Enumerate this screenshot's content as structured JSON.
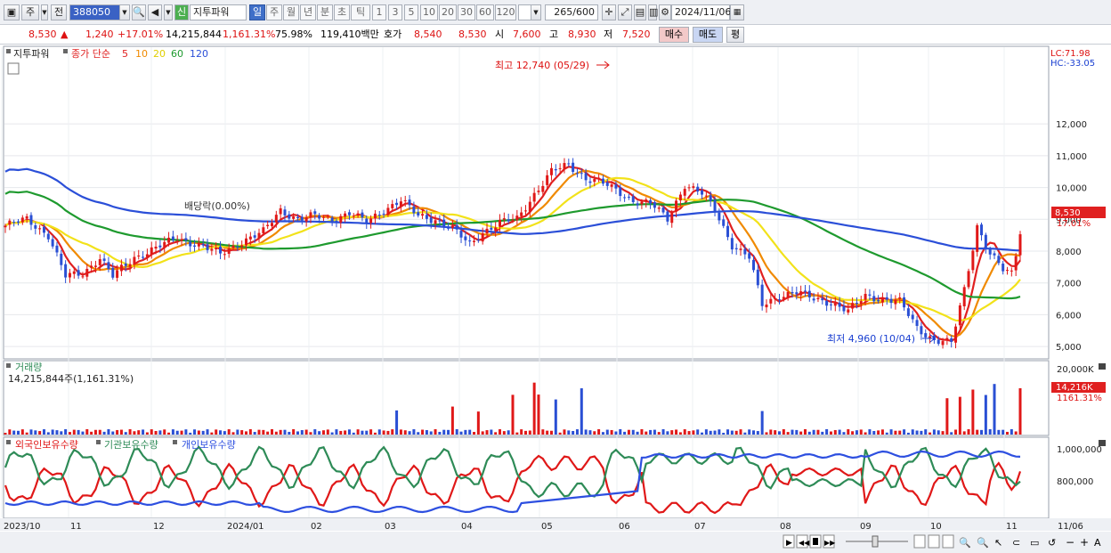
{
  "toolbar": {
    "market_label": "주",
    "prev_label": "전",
    "code": "388050",
    "stock_name": "지투파워",
    "new_badge": "신",
    "periods": [
      "일",
      "주",
      "월",
      "년",
      "분",
      "초",
      "틱"
    ],
    "active_period": "일",
    "intervals": [
      "1",
      "3",
      "5",
      "10",
      "20",
      "30",
      "60",
      "120"
    ],
    "count": "265",
    "count_total": "/600",
    "date": "2024/11/06"
  },
  "quote": {
    "price": "8,530",
    "change": "1,240",
    "change_pct": "+17.01%",
    "volume": "14,215,844",
    "volume_pct": "1,161.31%",
    "rate": "75.98%",
    "amount": "119,410백만",
    "hoga_label": "호가",
    "ask": "8,540",
    "bid": "8,530",
    "open_label": "시",
    "open": "7,600",
    "high_label": "고",
    "high": "8,930",
    "low_label": "저",
    "low": "7,520",
    "buy_label": "매수",
    "sell_label": "매도",
    "avg_label": "평"
  },
  "price_panel": {
    "title": "지투파워",
    "ma_label": "종가 단순",
    "ma_periods": [
      "5",
      "10",
      "20",
      "60",
      "120"
    ],
    "ma_colors": [
      "#e02020",
      "#f08a00",
      "#f2e21a",
      "#1e9a2e",
      "#2b4fd8"
    ],
    "lc": "LC:71.98",
    "hc": "HC:-33.05",
    "price_badge": "8,530",
    "pct_badge": "17.01%",
    "high_annot": "최고 12,740 (05/29)",
    "low_annot": "최저 4,960 (10/04)",
    "dividend": "배당락(0.00%)"
  },
  "volume_panel": {
    "title": "거래량",
    "value": "14,215,844주(1,161.31%)",
    "badge": "14,216K",
    "badge_pct": "1161.31%"
  },
  "holdings_panel": {
    "series_labels": [
      "외국인보유수량",
      "기관보유수량",
      "개인보유수량"
    ],
    "series_colors": [
      "#e01818",
      "#2e8b57",
      "#2d4fe0"
    ]
  },
  "x_labels": [
    "2023/10",
    "11",
    "12",
    "2024/01",
    "02",
    "03",
    "04",
    "05",
    "06",
    "07",
    "08",
    "09",
    "10",
    "11",
    "11/06"
  ],
  "chart_data": {
    "type": "candlestick",
    "ylim": [
      4500,
      12900
    ],
    "y_ticks": [
      "12,000",
      "11,000",
      "10,000",
      "9,000",
      "8,000",
      "7,000",
      "6,000",
      "5,000"
    ],
    "volume_ticks": [
      "20,000K"
    ],
    "holdings_ticks": [
      "1,000,000",
      "800,000"
    ],
    "close_anchors": [
      [
        0,
        8800
      ],
      [
        5,
        9000
      ],
      [
        10,
        8500
      ],
      [
        14,
        7200
      ],
      [
        18,
        7300
      ],
      [
        22,
        7800
      ],
      [
        25,
        7200
      ],
      [
        30,
        7800
      ],
      [
        35,
        8100
      ],
      [
        40,
        8400
      ],
      [
        45,
        8200
      ],
      [
        50,
        7900
      ],
      [
        55,
        8300
      ],
      [
        60,
        8600
      ],
      [
        64,
        9300
      ],
      [
        68,
        9000
      ],
      [
        72,
        9100
      ],
      [
        76,
        9000
      ],
      [
        80,
        9200
      ],
      [
        84,
        8900
      ],
      [
        88,
        9300
      ],
      [
        92,
        9600
      ],
      [
        96,
        9100
      ],
      [
        100,
        9000
      ],
      [
        104,
        8700
      ],
      [
        108,
        8200
      ],
      [
        111,
        8600
      ],
      [
        115,
        8900
      ],
      [
        119,
        9000
      ],
      [
        123,
        9800
      ],
      [
        127,
        10500
      ],
      [
        131,
        10700
      ],
      [
        135,
        10300
      ],
      [
        138,
        10200
      ],
      [
        142,
        9900
      ],
      [
        146,
        9600
      ],
      [
        150,
        9500
      ],
      [
        154,
        9000
      ],
      [
        158,
        10100
      ],
      [
        162,
        9800
      ],
      [
        165,
        9300
      ],
      [
        169,
        8200
      ],
      [
        173,
        7800
      ],
      [
        176,
        6300
      ],
      [
        180,
        6600
      ],
      [
        184,
        6700
      ],
      [
        188,
        6500
      ],
      [
        192,
        6400
      ],
      [
        196,
        6100
      ],
      [
        200,
        6600
      ],
      [
        204,
        6500
      ],
      [
        208,
        6400
      ],
      [
        212,
        5600
      ],
      [
        216,
        5200
      ],
      [
        220,
        5100
      ],
      [
        223,
        6800
      ],
      [
        226,
        8800
      ],
      [
        229,
        7900
      ],
      [
        232,
        7400
      ],
      [
        234,
        7300
      ],
      [
        236,
        8530
      ]
    ]
  }
}
